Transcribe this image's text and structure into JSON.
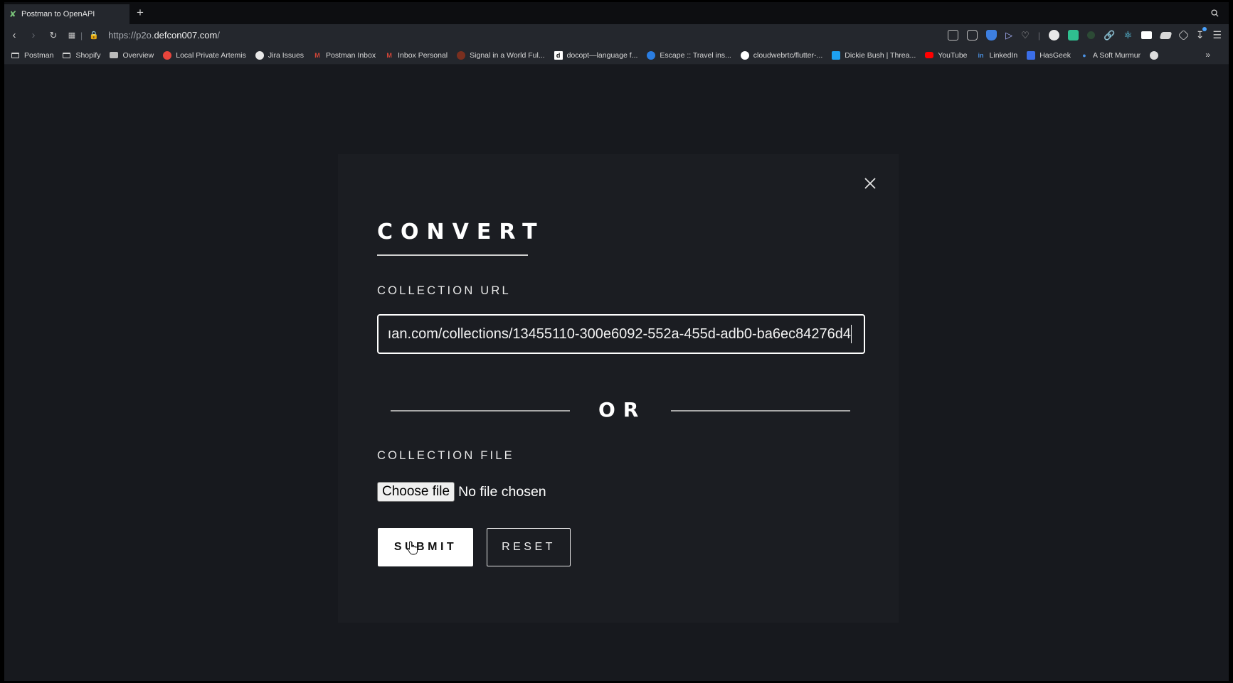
{
  "browser": {
    "tab_title": "Postman to OpenAPI",
    "new_tab": "+",
    "url_prefix": "https://p2o.",
    "url_domain": "defcon007.com",
    "url_suffix": "/",
    "bookmarks": [
      {
        "label": "Postman",
        "icon": "folder-icon",
        "color": ""
      },
      {
        "label": "Shopify",
        "icon": "folder-icon",
        "color": ""
      },
      {
        "label": "Overview",
        "icon": "car-icon",
        "color": "#bbbbbb"
      },
      {
        "label": "Local Private Artemis",
        "icon": "artemis-icon",
        "color": "#e8453c"
      },
      {
        "label": "Jira Issues",
        "icon": "jira-icon",
        "color": "#e8e8e8"
      },
      {
        "label": "Postman Inbox",
        "icon": "gmail-icon",
        "color": "#d44638"
      },
      {
        "label": "Inbox Personal",
        "icon": "gmail-icon",
        "color": "#d44638"
      },
      {
        "label": "Signal in a World Ful...",
        "icon": "signal-icon",
        "color": "#7a2f1f"
      },
      {
        "label": "docopt—language f...",
        "icon": "docopt-icon",
        "color": "#ffffff"
      },
      {
        "label": "Escape :: Travel ins...",
        "icon": "escape-icon",
        "color": "#2a7de1"
      },
      {
        "label": "cloudwebrtc/flutter-...",
        "icon": "github-icon",
        "color": "#ffffff"
      },
      {
        "label": "Dickie Bush | Threa...",
        "icon": "twitter-icon",
        "color": "#1da1f2"
      },
      {
        "label": "YouTube",
        "icon": "youtube-icon",
        "color": "#ff0000"
      },
      {
        "label": "LinkedIn",
        "icon": "linkedin-icon",
        "color": "#0a66c2"
      },
      {
        "label": "HasGeek",
        "icon": "hasgeek-icon",
        "color": "#3b6ee8"
      },
      {
        "label": "A Soft Murmur",
        "icon": "drop-icon",
        "color": "#4a90e2"
      }
    ]
  },
  "modal": {
    "title": "CONVERT",
    "url_label": "COLLECTION URL",
    "url_value": "ıan.com/collections/13455110-300e6092-552a-455d-adb0-ba6ec84276d4",
    "or_text": "OR",
    "file_label": "COLLECTION FILE",
    "choose_file_label": "Choose file",
    "file_status": "No file chosen",
    "submit_label": "SUBMIT",
    "reset_label": "RESET"
  },
  "colors": {
    "page_bg": "#17191e",
    "panel_bg": "#1b1d22",
    "accent": "#ffffff"
  }
}
